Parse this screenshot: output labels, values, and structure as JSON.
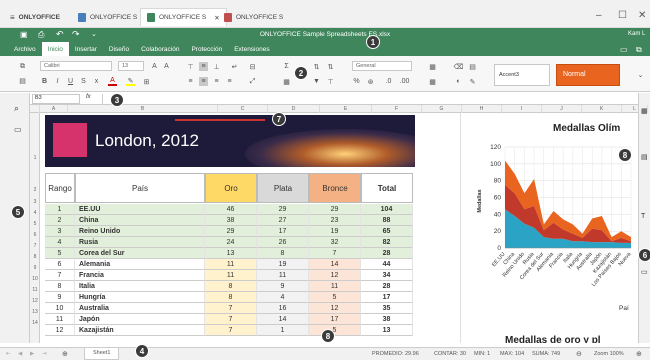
{
  "browser_tabs": [
    {
      "label": "ONLYOFFICE",
      "type": "brand"
    },
    {
      "label": "ONLYOFFICE S",
      "type": "doc"
    },
    {
      "label": "ONLYOFFICE S",
      "type": "sheet",
      "active": true
    },
    {
      "label": "ONLYOFFICE S",
      "type": "pres"
    }
  ],
  "window_controls": [
    "–",
    "☐",
    "✕"
  ],
  "title": "ONLYOFFICE Sample Spreadsheets ES.xlsx",
  "user": "Kam L",
  "menu": [
    "Archivo",
    "Inicio",
    "Insertar",
    "Diseño",
    "Colaboración",
    "Protección",
    "Extensiones"
  ],
  "toolbar": {
    "font_name": "Calibri",
    "font_size": "13",
    "number_format": "General",
    "style_accent": "Accent3",
    "style_normal": "Normal"
  },
  "formula_bar": {
    "cell_ref": "B3",
    "fx": "fx"
  },
  "columns": [
    "A",
    "B",
    "C",
    "D",
    "E",
    "F",
    "G",
    "H",
    "I",
    "J",
    "K",
    "L"
  ],
  "rows": [
    "1",
    "2",
    "3",
    "4",
    "5",
    "6",
    "7",
    "8",
    "9",
    "10",
    "11",
    "12",
    "13",
    "14"
  ],
  "banner_title": "London, 2012",
  "table_headers": [
    "Rango",
    "País",
    "Oro",
    "Plata",
    "Bronce",
    "Total"
  ],
  "table_rows": [
    [
      "1",
      "EE.UU",
      "46",
      "29",
      "29",
      "104"
    ],
    [
      "2",
      "China",
      "38",
      "27",
      "23",
      "88"
    ],
    [
      "3",
      "Reino Unido",
      "29",
      "17",
      "19",
      "65"
    ],
    [
      "4",
      "Rusia",
      "24",
      "26",
      "32",
      "82"
    ],
    [
      "5",
      "Corea del Sur",
      "13",
      "8",
      "7",
      "28"
    ],
    [
      "6",
      "Alemania",
      "11",
      "19",
      "14",
      "44"
    ],
    [
      "7",
      "Francia",
      "11",
      "11",
      "12",
      "34"
    ],
    [
      "8",
      "Italia",
      "8",
      "9",
      "11",
      "28"
    ],
    [
      "9",
      "Hungría",
      "8",
      "4",
      "5",
      "17"
    ],
    [
      "10",
      "Australia",
      "7",
      "16",
      "12",
      "35"
    ],
    [
      "11",
      "Japón",
      "7",
      "14",
      "17",
      "38"
    ],
    [
      "12",
      "Kazajistán",
      "7",
      "1",
      "5",
      "13"
    ]
  ],
  "chart_data": {
    "type": "area",
    "title": "Medallas Olím",
    "ylabel": "Medallas",
    "ylim": [
      0,
      120
    ],
    "yticks": [
      0,
      20,
      40,
      60,
      80,
      100,
      120
    ],
    "categories": [
      "EE.UU",
      "China",
      "Reino Unido",
      "Rusia",
      "Corea del Sur",
      "Alemania",
      "Francia",
      "Italia",
      "Hungría",
      "Australia",
      "Japón",
      "Kazajistán",
      "Los Países Bajos",
      "Nueva"
    ],
    "series": [
      {
        "values": [
          46,
          38,
          29,
          24,
          13,
          11,
          11,
          8,
          8,
          7,
          7,
          7,
          6,
          6
        ],
        "color": "#2aa3c4"
      },
      {
        "values": [
          29,
          27,
          17,
          26,
          8,
          19,
          11,
          9,
          4,
          16,
          14,
          1,
          6,
          2
        ],
        "color": "#c0392b"
      },
      {
        "values": [
          29,
          23,
          19,
          32,
          7,
          14,
          12,
          11,
          5,
          12,
          17,
          5,
          8,
          5
        ],
        "color": "#e8641f"
      }
    ],
    "legend_partial": "Paí",
    "grid": true
  },
  "second_chart_title": "Medallas de oro y pl",
  "sheet_tab": "Sheet1",
  "status": {
    "promedio": "PROMEDIO: 29.96",
    "contar": "CONTAR: 30",
    "min": "MIN: 1",
    "max": "MAX: 104",
    "suma": "SUMA: 749",
    "zoom": "Zoom 100%"
  },
  "callouts": [
    "1",
    "2",
    "3",
    "4",
    "5",
    "6",
    "7",
    "8",
    "8"
  ],
  "colors": {
    "brand_green": "#40865c",
    "gold": "#ffd966",
    "silver": "#d9d9d9",
    "bronze": "#f4b183",
    "row_green": "#e2efda"
  }
}
